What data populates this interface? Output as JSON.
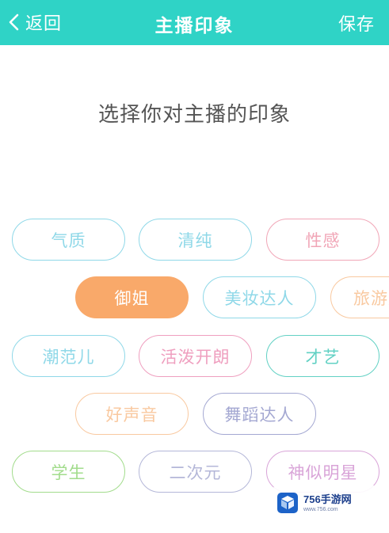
{
  "header": {
    "back_label": "返回",
    "title": "主播印象",
    "save_label": "保存",
    "background": "#2fd3c6"
  },
  "prompt": "选择你对主播的印象",
  "tags": [
    {
      "label": "气质",
      "color": "#8fd8e8",
      "selected": false
    },
    {
      "label": "清纯",
      "color": "#8fd8e8",
      "selected": false
    },
    {
      "label": "性感",
      "color": "#f1a6b7",
      "selected": false
    },
    {
      "label": "御姐",
      "color": "#f9a96a",
      "selected": true
    },
    {
      "label": "美妆达人",
      "color": "#8fd8e8",
      "selected": false
    },
    {
      "label": "旅游达",
      "color": "#f9c9a0",
      "selected": false
    },
    {
      "label": "潮范儿",
      "color": "#8fd8e8",
      "selected": false
    },
    {
      "label": "活泼开朗",
      "color": "#ef9fbf",
      "selected": false
    },
    {
      "label": "才艺",
      "color": "#62d1c4",
      "selected": false
    },
    {
      "label": "好声音",
      "color": "#f9c9a0",
      "selected": false
    },
    {
      "label": "舞蹈达人",
      "color": "#a4a8d2",
      "selected": false
    },
    {
      "label": "学生",
      "color": "#a2dc8c",
      "selected": false
    },
    {
      "label": "二次元",
      "color": "#b4b7d8",
      "selected": false
    },
    {
      "label": "神似明星",
      "color": "#d9a4d8",
      "selected": false
    }
  ],
  "watermark": {
    "main": "756手游网",
    "sub": "www.756.com",
    "icon": "cube-logo-icon"
  }
}
